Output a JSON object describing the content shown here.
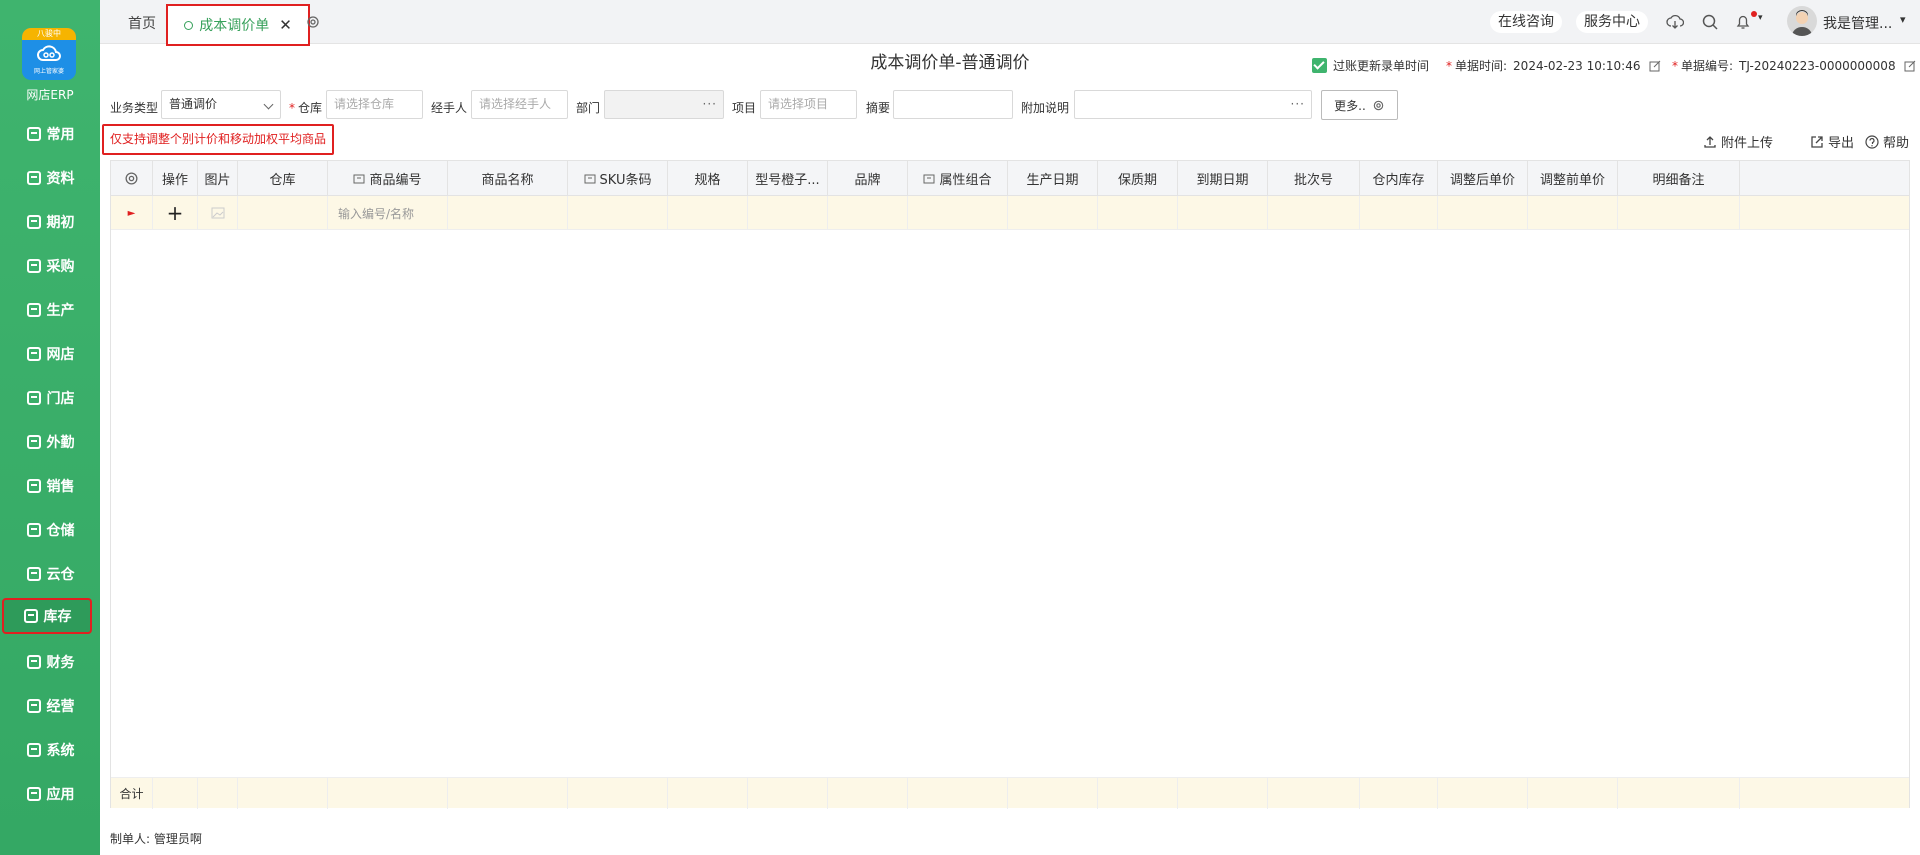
{
  "sidebar": {
    "logo_badge": "八骏中",
    "logo_sub": "网上管家婆",
    "app_name": "网店ERP",
    "items": [
      {
        "label": "常用",
        "icon": "star-icon"
      },
      {
        "label": "资料",
        "icon": "document-icon"
      },
      {
        "label": "期初",
        "icon": "clock-icon"
      },
      {
        "label": "采购",
        "icon": "cart-icon"
      },
      {
        "label": "生产",
        "icon": "factory-icon"
      },
      {
        "label": "网店",
        "icon": "shop-icon"
      },
      {
        "label": "门店",
        "icon": "store-icon"
      },
      {
        "label": "外勤",
        "icon": "location-icon"
      },
      {
        "label": "销售",
        "icon": "chart-icon"
      },
      {
        "label": "仓储",
        "icon": "warehouse-icon"
      },
      {
        "label": "云仓",
        "icon": "cloud-warehouse-icon"
      },
      {
        "label": "库存",
        "icon": "home-icon"
      },
      {
        "label": "财务",
        "icon": "wallet-icon"
      },
      {
        "label": "经营",
        "icon": "trend-icon"
      },
      {
        "label": "系统",
        "icon": "settings-icon"
      },
      {
        "label": "应用",
        "icon": "plus-box-icon"
      }
    ],
    "active": "库存"
  },
  "tabs": {
    "home": "首页",
    "active": "成本调价单",
    "close": "✕"
  },
  "topbar": {
    "consult": "在线咨询",
    "service": "服务中心",
    "user": "我是管理...",
    "user_caret": "▾"
  },
  "header": {
    "title": "成本调价单-普通调价",
    "update_time_label": "过账更新录单时间",
    "doc_time_label": "单据时间:",
    "doc_time_value": "2024-02-23 10:10:46",
    "doc_no_label": "单据编号:",
    "doc_no_value": "TJ-20240223-0000000008",
    "required_mark": "*"
  },
  "form": {
    "biz_type_label": "业务类型",
    "biz_type_value": "普通调价",
    "warehouse_label": "仓库",
    "warehouse_placeholder": "请选择仓库",
    "handler_label": "经手人",
    "handler_placeholder": "请选择经手人",
    "dept_label": "部门",
    "project_label": "项目",
    "project_placeholder": "请选择项目",
    "summary_label": "摘要",
    "note_label": "附加说明",
    "more_label": "更多..",
    "ellipsis": "···"
  },
  "notice": "仅支持调整个别计价和移动加权平均商品",
  "tools": {
    "upload": "附件上传",
    "export": "导出",
    "help": "帮助"
  },
  "table": {
    "columns": [
      "操作",
      "图片",
      "仓库",
      "商品编号",
      "商品名称",
      "SKU条码",
      "规格",
      "型号橙子...",
      "品牌",
      "属性组合",
      "生产日期",
      "保质期",
      "到期日期",
      "批次号",
      "仓内库存",
      "调整后单价",
      "调整前单价",
      "明细备注"
    ],
    "row_marker": "►",
    "add_symbol": "+",
    "input_placeholder": "输入编号/名称",
    "footer_label": "合计"
  },
  "maker": "制单人: 管理员啊"
}
